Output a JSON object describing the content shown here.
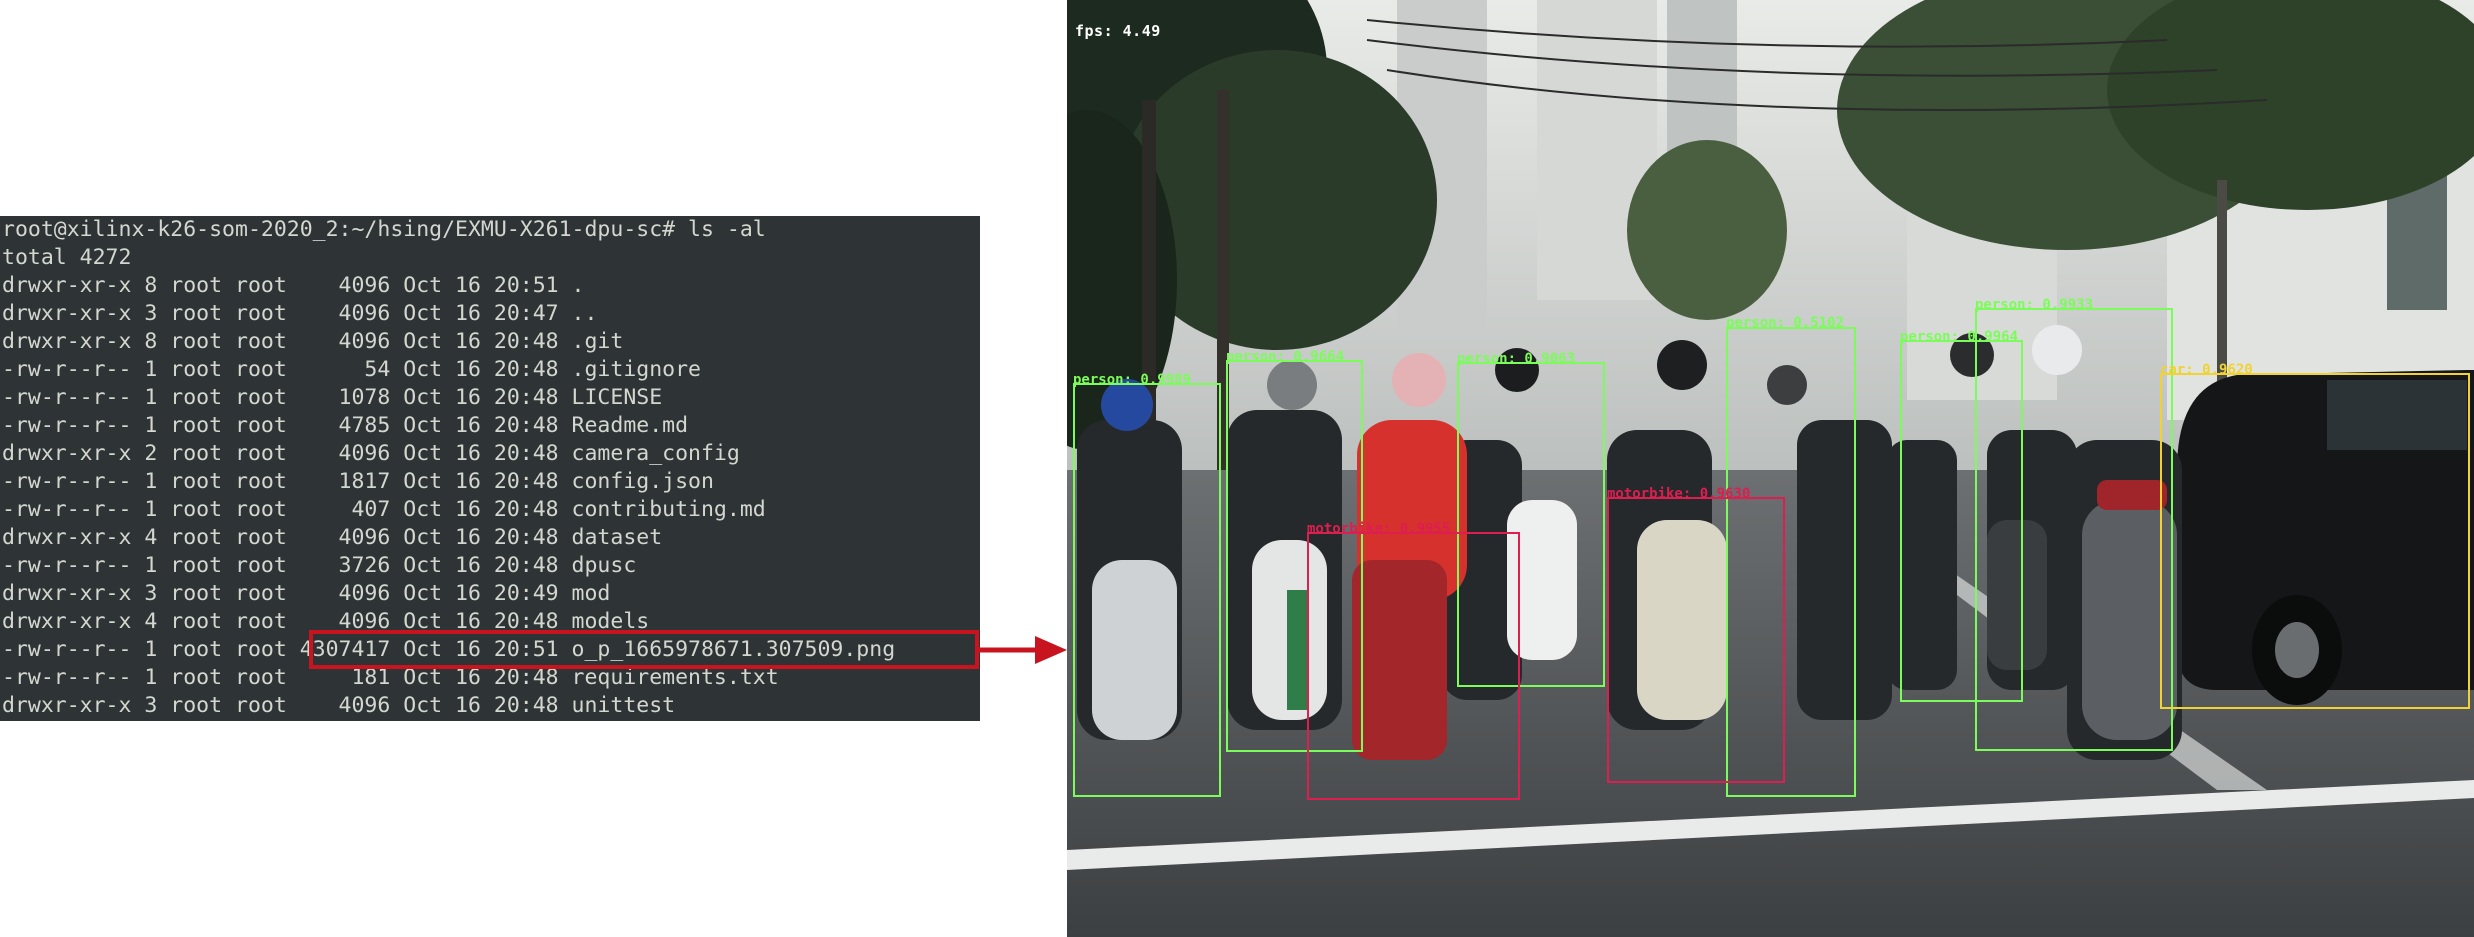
{
  "terminal": {
    "lines": [
      "root@xilinx-k26-som-2020_2:~/hsing/EXMU-X261-dpu-sc# ls -al",
      "total 4272",
      "drwxr-xr-x 8 root root    4096 Oct 16 20:51 .",
      "drwxr-xr-x 3 root root    4096 Oct 16 20:47 ..",
      "drwxr-xr-x 8 root root    4096 Oct 16 20:48 .git",
      "-rw-r--r-- 1 root root      54 Oct 16 20:48 .gitignore",
      "-rw-r--r-- 1 root root    1078 Oct 16 20:48 LICENSE",
      "-rw-r--r-- 1 root root    4785 Oct 16 20:48 Readme.md",
      "drwxr-xr-x 2 root root    4096 Oct 16 20:48 camera_config",
      "-rw-r--r-- 1 root root    1817 Oct 16 20:48 config.json",
      "-rw-r--r-- 1 root root     407 Oct 16 20:48 contributing.md",
      "drwxr-xr-x 4 root root    4096 Oct 16 20:48 dataset",
      "-rw-r--r-- 1 root root    3726 Oct 16 20:48 dpusc",
      "drwxr-xr-x 3 root root    4096 Oct 16 20:49 mod",
      "drwxr-xr-x 4 root root    4096 Oct 16 20:48 models",
      "-rw-r--r-- 1 root root 4307417 Oct 16 20:51 o_p_1665978671.307509.png",
      "-rw-r--r-- 1 root root     181 Oct 16 20:48 requirements.txt",
      "drwxr-xr-x 3 root root    4096 Oct 16 20:48 unittest"
    ],
    "highlight_color": "#c8141e"
  },
  "detection": {
    "fps_label": "fps: 4.49",
    "colors": {
      "person": "#7cfc5a",
      "motorbike": "#dc1e50",
      "car": "#f0d232"
    },
    "boxes": [
      {
        "label": "person: 0.9989",
        "cls": "person"
      },
      {
        "label": "person: 0.9664",
        "cls": "person"
      },
      {
        "label": "person: 0.9063",
        "cls": "person"
      },
      {
        "label": "person: 0.5102",
        "cls": "person"
      },
      {
        "label": "person: 0.9964",
        "cls": "person"
      },
      {
        "label": "person: 0.9933",
        "cls": "person"
      },
      {
        "label": "motorbike: 0.9955",
        "cls": "motorbike"
      },
      {
        "label": "motorbike: 0.9630",
        "cls": "motorbike"
      },
      {
        "label": "car: 0.9620",
        "cls": "car"
      }
    ]
  }
}
